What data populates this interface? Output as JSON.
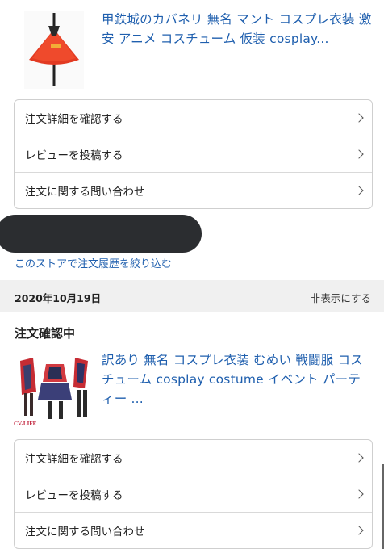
{
  "order1": {
    "title": "甲鉄城のカバネリ 無名 マント コスプレ衣装 激安 アニメ コスチューム 仮装 cosplay...",
    "actions": [
      {
        "label": "注文詳細を確認する"
      },
      {
        "label": "レビューを投稿する"
      },
      {
        "label": "注文に関する問い合わせ"
      }
    ]
  },
  "filter_link": "このストアで注文履歴を絞り込む",
  "order2": {
    "date": "2020年10月19日",
    "hide_label": "非表示にする",
    "status": "注文確認中",
    "title": "訳あり 無名 コスプレ衣装 むめい 戦闘服 コスチューム cosplay costume イベント パーティー ...",
    "image_mark": "CV-LIFE",
    "actions": [
      {
        "label": "注文詳細を確認する"
      },
      {
        "label": "レビューを投稿する"
      },
      {
        "label": "注文に関する問い合わせ"
      }
    ]
  },
  "colors": {
    "link": "#1f5fae",
    "band": "#f0f0f0",
    "redaction": "#2b2d30"
  }
}
